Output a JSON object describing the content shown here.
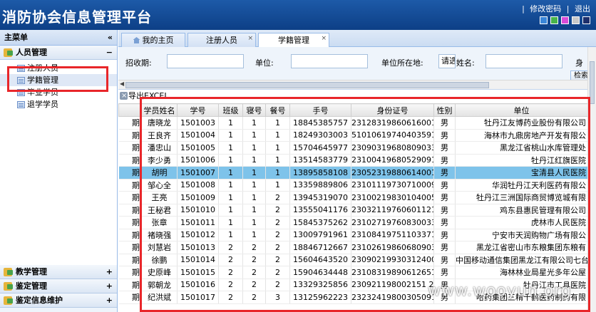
{
  "header": {
    "title": "消防协会信息管理平台",
    "links": [
      "修改密码",
      "退出"
    ],
    "theme_colors": [
      "#3a86d8",
      "#48b44a",
      "#d84bd8",
      "#c9c9c9",
      "#1d2f6b"
    ]
  },
  "sidebar": {
    "title": "主菜单",
    "collapse": "«",
    "groups_top": [
      {
        "label": "人员管理",
        "ctl": "−"
      }
    ],
    "items": [
      {
        "label": "注册人员"
      },
      {
        "label": "学籍管理"
      },
      {
        "label": "毕业学员"
      },
      {
        "label": "退学学员"
      }
    ],
    "groups_bottom": [
      {
        "label": "教学管理",
        "ctl": "+"
      },
      {
        "label": "鉴定管理",
        "ctl": "+"
      },
      {
        "label": "鉴定信息维护",
        "ctl": "+"
      }
    ]
  },
  "tabs": [
    {
      "label": "我的主页"
    },
    {
      "label": "注册人员",
      "close": "×"
    },
    {
      "label": "学籍管理",
      "close": "×"
    }
  ],
  "filter": {
    "enroll_label": "招收期:",
    "unit_label": "单位:",
    "location_label": "单位所在地:",
    "location_value": "请选",
    "name_label": "姓名:",
    "id_label": "身",
    "search_button": "检索"
  },
  "toolbar": {
    "export_label": "导出EXCEL"
  },
  "grid": {
    "prefix": "期",
    "columns": [
      "学员姓名",
      "学号",
      "班级",
      "寝号",
      "餐号",
      "手号",
      "身份证号",
      "性别",
      "单位"
    ],
    "rows": [
      [
        "唐晓龙",
        "1501003",
        "1",
        "1",
        "1",
        "18845385757",
        "231283198606160013X",
        "男",
        "牡丹江友博药业股份有限公司"
      ],
      [
        "王良齐",
        "1501004",
        "1",
        "1",
        "1",
        "18249303003",
        "510106197404035919",
        "男",
        "海林市九鼎房地产开发有限公"
      ],
      [
        "潘忠山",
        "1501005",
        "1",
        "1",
        "1",
        "15704645977",
        "230903196808090335",
        "男",
        "黑龙江省桃山水库管理处"
      ],
      [
        "李少勇",
        "1501006",
        "1",
        "1",
        "1",
        "13514583779",
        "231004196805290911",
        "男",
        "牡丹江红旗医院"
      ],
      [
        "胡明",
        "1501007",
        "1",
        "1",
        "1",
        "13895858108",
        "230523198806140012",
        "男",
        "宝清县人民医院"
      ],
      [
        "邹心全",
        "1501008",
        "1",
        "1",
        "1",
        "13359889806",
        "231011197307100095X",
        "男",
        "华润牡丹江天利医药有限公"
      ],
      [
        "王亮",
        "1501009",
        "1",
        "1",
        "2",
        "13945319070",
        "231002198301040051X",
        "男",
        "牡丹江三洲国际商贸博览城有限"
      ],
      [
        "王秘君",
        "1501010",
        "1",
        "1",
        "2",
        "13555041176",
        "230321197606011218",
        "男",
        "鸡东县惠民管理有限公司"
      ],
      [
        "张章",
        "1501011",
        "1",
        "1",
        "2",
        "15845375262",
        "231027197608300331",
        "男",
        "虎林市人民医院"
      ],
      [
        "褚晓强",
        "1501012",
        "1",
        "1",
        "2",
        "13009791961",
        "231084197511033713",
        "男",
        "宁安市天润购物广场有限公"
      ],
      [
        "刘慧岩",
        "1501013",
        "2",
        "2",
        "2",
        "18846712667",
        "231026198606809031X",
        "男",
        "黑龙江省密山市东粮集团东粮有"
      ],
      [
        "徐鹏",
        "1501014",
        "2",
        "2",
        "2",
        "15604643520",
        "230902199303124001 2",
        "男",
        "中国移动通信集团黑龙江有限公司七台"
      ],
      [
        "史原峰",
        "1501015",
        "2",
        "2",
        "2",
        "15904634448",
        "231083198906126517",
        "男",
        "海林林业局星光多年公屋"
      ],
      [
        "郭朝龙",
        "1501016",
        "2",
        "2",
        "2",
        "13329325856",
        "230921198002151 25X",
        "男",
        "牡丹江市工具医院"
      ],
      [
        "纪洪斌",
        "1501017",
        "2",
        "2",
        "3",
        "13125962223",
        "232324198003050918",
        "男",
        "哈药集团三精千鹤医药制药有限"
      ]
    ],
    "selected_index": 4
  },
  "watermark": "www.wooyun.org"
}
